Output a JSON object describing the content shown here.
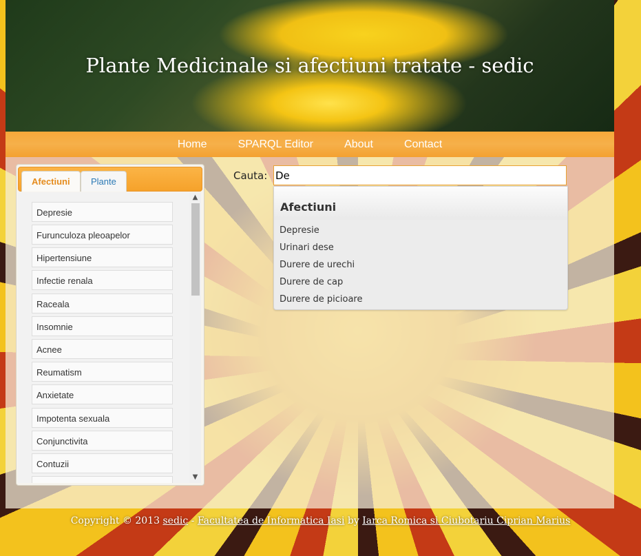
{
  "header": {
    "title": "Plante Medicinale si afectiuni tratate - sedic"
  },
  "nav": {
    "items": [
      "Home",
      "SPARQL Editor",
      "About",
      "Contact"
    ]
  },
  "tabs": {
    "afectiuni": "Afectiuni",
    "plante": "Plante"
  },
  "list": {
    "items": [
      "Depresie",
      "Furunculoza pleoapelor",
      "Hipertensiune",
      "Infectie renala",
      "Raceala",
      "Insomnie",
      "Acnee",
      "Reumatism",
      "Anxietate",
      "Impotenta sexuala",
      "Conjunctivita",
      "Contuzii"
    ]
  },
  "search": {
    "label": "Cauta:",
    "value": "De",
    "suggest_header": "Afectiuni",
    "suggestions": [
      "Depresie",
      "Urinari dese",
      "Durere de urechi",
      "Durere de cap",
      "Durere de picioare"
    ]
  },
  "footer": {
    "copyright": "Copyright © 2013 ",
    "site_link": "sedic",
    "sep": " - ",
    "faculty_link": "Facultatea de Informatica Iasi",
    "by": " by ",
    "authors_link": "Iarca Romica si Ciubotariu Ciprian Marius"
  },
  "colors": {
    "accent": "#f7a83a",
    "tab_active": "#e58c1d",
    "link": "#2b79b5"
  }
}
